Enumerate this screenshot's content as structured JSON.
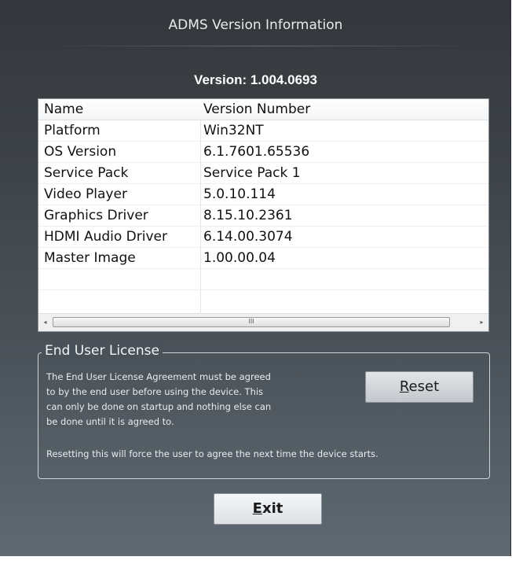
{
  "dialog": {
    "title": "ADMS Version Information",
    "version_text": "Version: 1.004.0693"
  },
  "table": {
    "columns": [
      "Name",
      "Version Number"
    ],
    "rows": [
      {
        "name": "Platform",
        "version": "Win32NT"
      },
      {
        "name": "OS Version",
        "version": "6.1.7601.65536"
      },
      {
        "name": "Service Pack",
        "version": "Service Pack 1"
      },
      {
        "name": "Video Player",
        "version": "5.0.10.114"
      },
      {
        "name": "Graphics Driver",
        "version": "8.15.10.2361"
      },
      {
        "name": "HDMI Audio Driver",
        "version": "6.14.00.3074"
      },
      {
        "name": "Master Image",
        "version": "1.00.00.04"
      }
    ],
    "scroll_left_glyph": "◂",
    "scroll_right_glyph": "▸",
    "scroll_grip": "III"
  },
  "license": {
    "title": "End User License",
    "para1_lines": [
      "The End User License Agreement must be agreed",
      "to by the end user before using the device.  This",
      "can only be done on startup and nothing else can",
      "be done until it is agreed to."
    ],
    "para2": "Resetting this will force the user to agree the next time the device starts.",
    "reset_mnemonic": "R",
    "reset_rest": "eset"
  },
  "exit": {
    "mnemonic": "E",
    "rest": "xit"
  },
  "colors": {
    "background_top": "#33373b",
    "background_bottom": "#5e6971",
    "panel_text": "#e9ecee"
  }
}
